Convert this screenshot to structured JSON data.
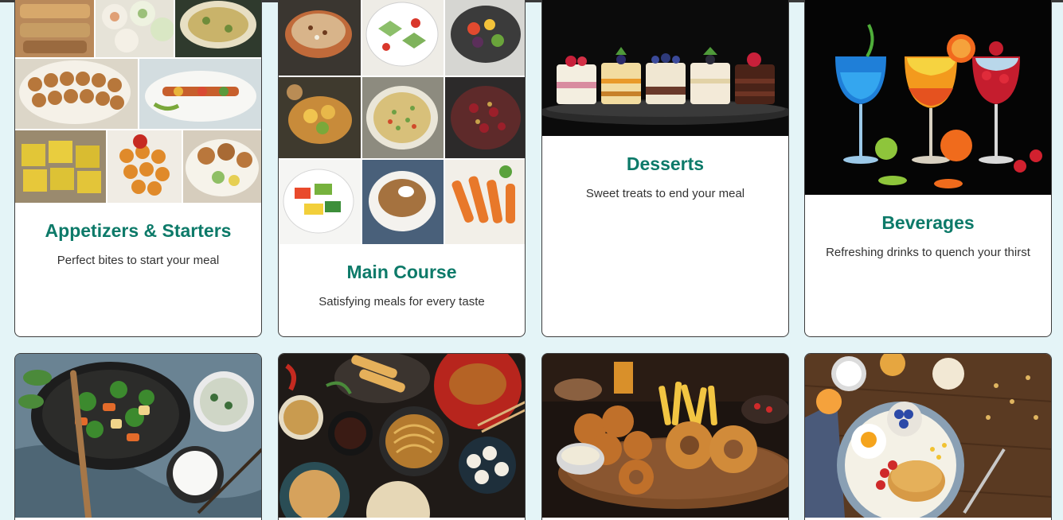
{
  "categories": [
    {
      "title": "Appetizers & Starters",
      "description": "Perfect bites to start your meal",
      "image": "appetizers-collage-image"
    },
    {
      "title": "Main Course",
      "description": "Satisfying meals for every taste",
      "image": "main-course-collage-image"
    },
    {
      "title": "Desserts",
      "description": "Sweet treats to end your meal",
      "image": "desserts-image"
    },
    {
      "title": "Beverages",
      "description": "Refreshing drinks to quench your thirst",
      "image": "beverages-image"
    },
    {
      "title": "",
      "description": "",
      "image": "stir-fry-bowl-image"
    },
    {
      "title": "",
      "description": "",
      "image": "asian-feast-image"
    },
    {
      "title": "",
      "description": "",
      "image": "fried-food-platter-image"
    },
    {
      "title": "",
      "description": "",
      "image": "breakfast-plate-image"
    }
  ],
  "colors": {
    "background": "#e4f4f7",
    "title": "#0d7a69",
    "description": "#333333",
    "card": "#ffffff",
    "card_border": "#3d3d3d"
  }
}
